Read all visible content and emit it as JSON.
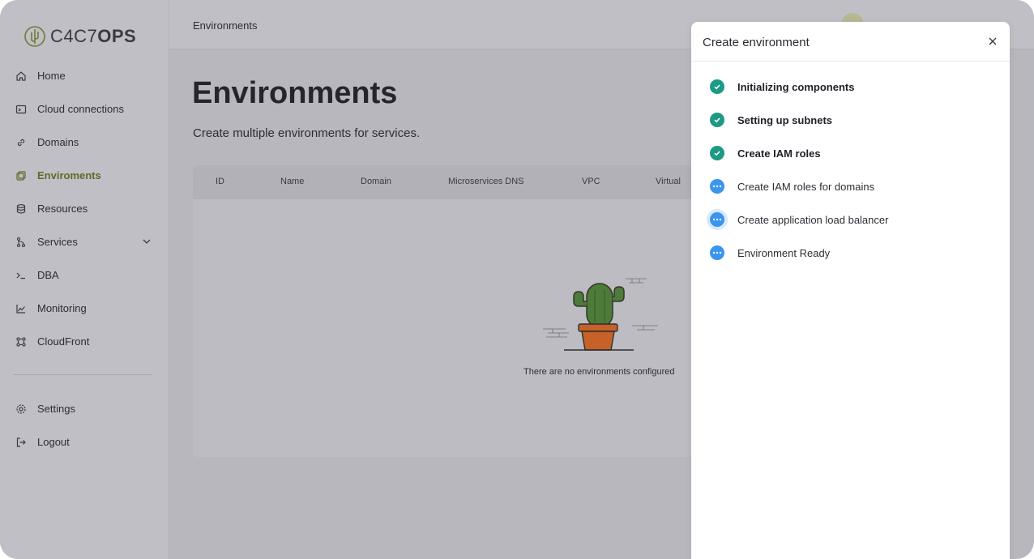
{
  "app": {
    "logo_text_light": "C4C7",
    "logo_text_bold": "OPS"
  },
  "sidebar": {
    "items": [
      {
        "label": "Home",
        "icon": "home-icon"
      },
      {
        "label": "Cloud connections",
        "icon": "terminal-window-icon"
      },
      {
        "label": "Domains",
        "icon": "link-icon"
      },
      {
        "label": "Enviroments",
        "icon": "copy-icon",
        "active": true
      },
      {
        "label": "Resources",
        "icon": "database-icon"
      },
      {
        "label": "Services",
        "icon": "git-branch-icon",
        "expandable": true
      },
      {
        "label": "DBA",
        "icon": "prompt-icon"
      },
      {
        "label": "Monitoring",
        "icon": "chart-line-icon"
      },
      {
        "label": "CloudFront",
        "icon": "nodes-icon"
      }
    ],
    "bottom_items": [
      {
        "label": "Settings",
        "icon": "gear-icon"
      },
      {
        "label": "Logout",
        "icon": "logout-icon"
      }
    ],
    "active_color": "#5e6a2a"
  },
  "topbar": {
    "breadcrumb": "Environments"
  },
  "main": {
    "title": "Environments",
    "subtitle": "Create multiple environments for services.",
    "table": {
      "columns": [
        "ID",
        "Name",
        "Domain",
        "Microservices DNS",
        "VPC",
        "Virtual"
      ],
      "empty_message": "There are no environments configured"
    }
  },
  "drawer": {
    "title": "Create environment",
    "steps": [
      {
        "label": "Initializing components",
        "status": "done"
      },
      {
        "label": "Setting up subnets",
        "status": "done"
      },
      {
        "label": "Create IAM roles",
        "status": "done"
      },
      {
        "label": "Create IAM roles for domains",
        "status": "pending"
      },
      {
        "label": "Create application load balancer",
        "status": "current"
      },
      {
        "label": "Environment Ready",
        "status": "pending"
      }
    ],
    "colors": {
      "done": "#1c9a86",
      "pending": "#3a95ee"
    }
  }
}
